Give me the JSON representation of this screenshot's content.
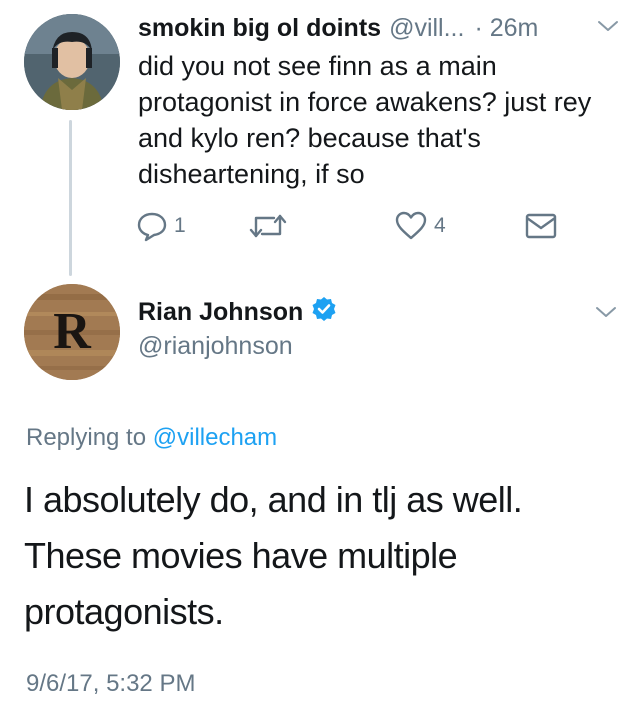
{
  "original_tweet": {
    "display_name": "smokin big ol doints",
    "handle": "@vill...",
    "separator": "·",
    "time_ago": "26m",
    "text": "did you not see finn as a main protagonist in force awakens? just rey and kylo ren? because that's disheartening, if so",
    "actions": {
      "reply_count": "1",
      "retweet_count": "",
      "like_count": "4"
    },
    "avatar_icon": "user-avatar-icon",
    "caret_icon": "chevron-down-icon"
  },
  "reply_tweet": {
    "display_name": "Rian Johnson",
    "handle": "@rianjohnson",
    "verified": true,
    "avatar_letter": "R",
    "replying_to_label": "Replying to",
    "replying_to_handle": "@villecham",
    "text": "I absolutely do, and in tlj as well. These movies have multiple protagonists.",
    "timestamp": "9/6/17, 5:32 PM",
    "caret_icon": "chevron-down-icon"
  },
  "colors": {
    "text_primary": "#14171a",
    "text_secondary": "#657786",
    "link_blue": "#1da1f2",
    "thread_line": "#cdd6dd"
  }
}
